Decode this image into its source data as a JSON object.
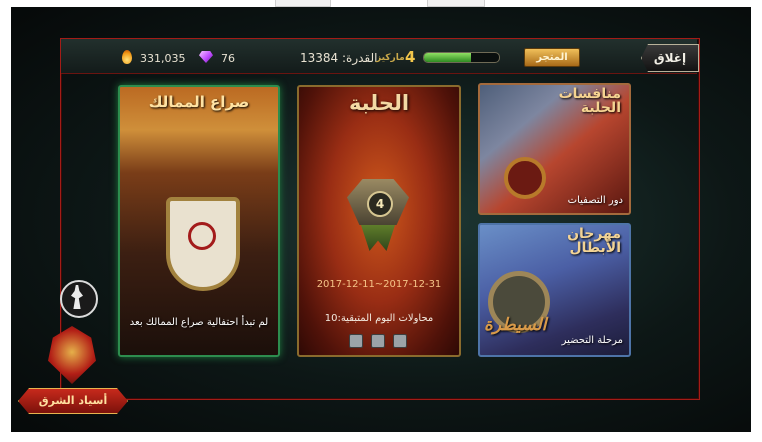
{
  "top_bar": {
    "gold": "331,035",
    "gems": "76",
    "power": "القدرة: 13384",
    "medals_count": "4",
    "medals_label": "ماركيز",
    "progress_fraction": 0.62,
    "store_label": "المتجر",
    "close_label": "إغلاق"
  },
  "cards": {
    "kingdoms": {
      "title": "صراع الممالك",
      "subtitle": "لم تبدأ احتفالية صراع الممالك بعد"
    },
    "arena": {
      "title": "الحلبة",
      "badge_number": "4",
      "dates": "2017-12-11~2017-12-31",
      "attempts": "محاولات اليوم المتبقية:10"
    },
    "qualifiers": {
      "title_line1": "منافسات",
      "title_line2": "الحلبة",
      "subtitle": "دور التصفيات"
    },
    "heroes_festival": {
      "title_line1": "مهرجان",
      "title_line2": "الأبطال",
      "mark": "السيطرة",
      "subtitle": "مرحلة التحضير"
    }
  },
  "logo_text": "أسياد الشرق",
  "icons": {
    "gold": "flame-icon",
    "gems": "gem-icon",
    "warrior": "warrior-icon"
  },
  "colors": {
    "frame_border": "#a31c17",
    "progress_fill": "#5fbf3f",
    "store_button": "#d89a38"
  }
}
